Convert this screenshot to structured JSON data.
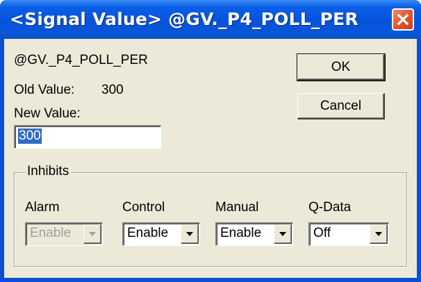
{
  "dialog": {
    "title": "<Signal Value> @GV._P4_POLL_PER",
    "signal_name": "@GV._P4_POLL_PER",
    "old_value_label": "Old Value:",
    "old_value": "300",
    "new_value_label": "New Value:",
    "new_value": "300",
    "ok_label": "OK",
    "cancel_label": "Cancel"
  },
  "inhibits": {
    "group_label": "Inhibits",
    "alarm": {
      "label": "Alarm",
      "value": "Enable",
      "enabled": false
    },
    "control": {
      "label": "Control",
      "value": "Enable",
      "enabled": true
    },
    "manual": {
      "label": "Manual",
      "value": "Enable",
      "enabled": true
    },
    "qdata": {
      "label": "Q-Data",
      "value": "Off",
      "enabled": true
    }
  },
  "colors": {
    "titlebar": "#0653dc",
    "dialog_background": "#ece9d8",
    "selection": "#316ac5",
    "close_button": "#e05a30"
  },
  "icons": {
    "close": "close-icon",
    "dropdown": "chevron-down-icon"
  }
}
